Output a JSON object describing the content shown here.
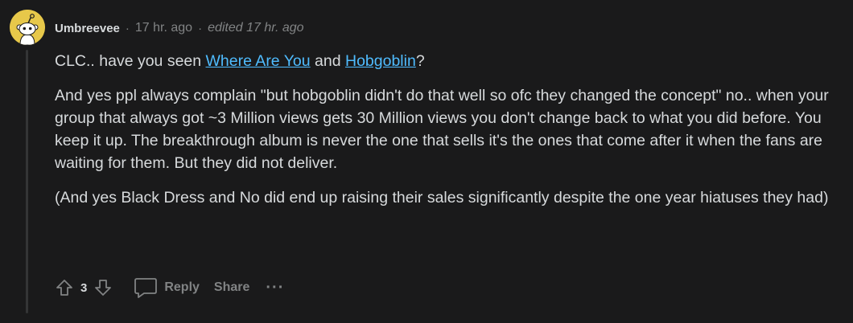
{
  "author": "Umbreevee",
  "separator": "·",
  "timestamp": "17 hr. ago",
  "edited": "edited 17 hr. ago",
  "body": {
    "p1_before": "CLC.. have you seen ",
    "link1": "Where Are You",
    "p1_mid": " and ",
    "link2": "Hobgoblin",
    "p1_after": "?",
    "p2": "And yes ppl always complain \"but hobgoblin didn't do that well so ofc they changed the concept\" no.. when your group that always got ~3 Million views gets 30 Million views you don't change back to what you did before. You keep it up. The breakthrough album is never the one that sells it's the ones that come after it when the fans are waiting for them. But they did not deliver.",
    "p3": "(And yes Black Dress and No did end up raising their sales significantly despite the one year hiatuses they had)"
  },
  "actions": {
    "vote_count": "3",
    "reply_label": "Reply",
    "share_label": "Share",
    "more_label": "···"
  },
  "icons": {
    "upvote": "arrow-up-icon",
    "downvote": "arrow-down-icon",
    "reply": "speech-bubble-icon",
    "more": "ellipsis-icon",
    "avatar": "snoo-avatar"
  },
  "colors": {
    "background": "#1a1a1b",
    "text": "#d7dadc",
    "muted": "#818384",
    "link": "#4fbcff",
    "avatar_bg": "#e7c84a"
  }
}
